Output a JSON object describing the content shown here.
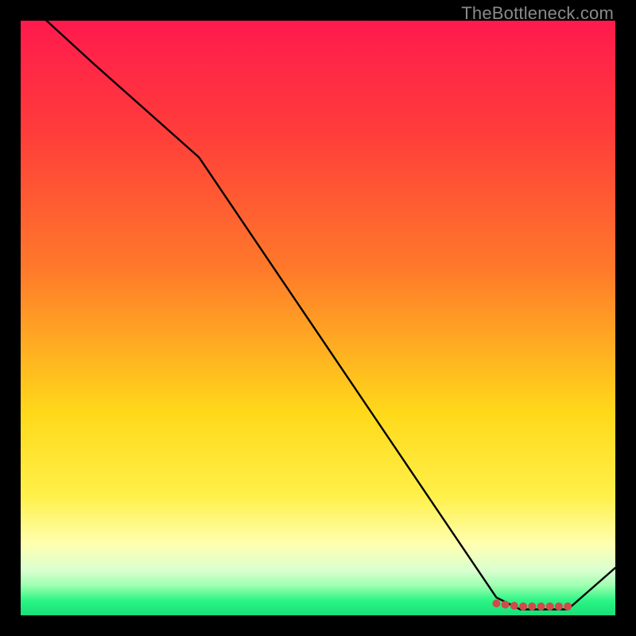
{
  "watermark": "TheBottleneck.com",
  "chart_data": {
    "type": "line",
    "title": "",
    "xlabel": "",
    "ylabel": "",
    "xlim": [
      0,
      100
    ],
    "ylim": [
      0,
      100
    ],
    "grid": false,
    "series": [
      {
        "name": "curve",
        "x": [
          0,
          12,
          30,
          80,
          84,
          92,
          100
        ],
        "y": [
          104,
          93,
          77,
          3,
          1,
          1,
          8
        ],
        "color": "#000000"
      }
    ],
    "markers": {
      "x": [
        80,
        81.5,
        83,
        84.5,
        86,
        87.5,
        89,
        90.5,
        92
      ],
      "y": [
        2.0,
        1.8,
        1.6,
        1.5,
        1.5,
        1.5,
        1.5,
        1.5,
        1.5
      ],
      "color": "#d24a4a",
      "radius": 5
    }
  }
}
